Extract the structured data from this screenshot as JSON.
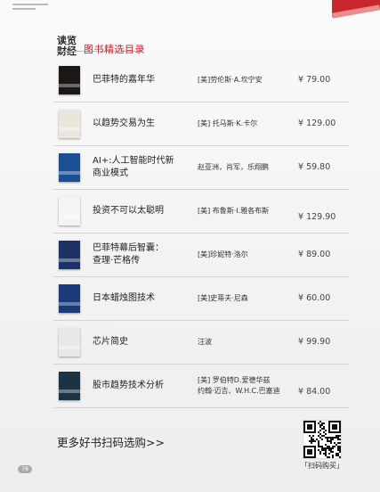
{
  "brand": {
    "logo_line1": "读览",
    "logo_line2": "财经"
  },
  "section_title": "图书精选目录",
  "books": [
    {
      "title_lines": [
        "巴菲特的嘉年华"
      ],
      "author_lines": [
        "[美]劳伦斯·A.坎宁安"
      ],
      "price": "¥ 79.00",
      "cover_color": "#1a1714"
    },
    {
      "title_lines": [
        "以趋势交易为生"
      ],
      "author_lines": [
        "[美] 托马斯·K.卡尔"
      ],
      "price": "¥ 129.00",
      "cover_color": "#ebe6dc"
    },
    {
      "title_lines": [
        "AI+:人工智能时代新",
        "商业模式"
      ],
      "author_lines": [
        "赵亚洲，肖军，乐翔鹏"
      ],
      "price": "¥ 59.80",
      "cover_color": "#1d4f94"
    },
    {
      "title_lines": [
        "投资不可以太聪明"
      ],
      "author_lines": [
        "[美] 布鲁斯·I.雅各布斯"
      ],
      "price": "¥ 129.90",
      "cover_color": "#f4f4f4"
    },
    {
      "title_lines": [
        "巴菲特幕后智囊：",
        "查理·芒格传"
      ],
      "author_lines": [
        "[美]珍妮特·洛尔"
      ],
      "price": "¥ 89.00",
      "cover_color": "#1d3264"
    },
    {
      "title_lines": [
        "日本蜡烛图技术"
      ],
      "author_lines": [
        "[美]史蒂夫·尼森"
      ],
      "price": "¥ 60.00",
      "cover_color": "#1b3a7a"
    },
    {
      "title_lines": [
        "芯片简史"
      ],
      "author_lines": [
        "汪波"
      ],
      "price": "¥ 99.90",
      "cover_color": "#e8e8e8"
    },
    {
      "title_lines": [
        "股市趋势技术分析"
      ],
      "author_lines": [
        "[美] 罗伯特D.爱德华兹",
        "约翰·迈吉、W.H.C.巴塞迪"
      ],
      "price": "¥ 84.00",
      "cover_color": "#1c3344"
    }
  ],
  "more_books": "更多好书扫码选购>>",
  "qr_label": "「扫码购买」",
  "page_number": "78"
}
